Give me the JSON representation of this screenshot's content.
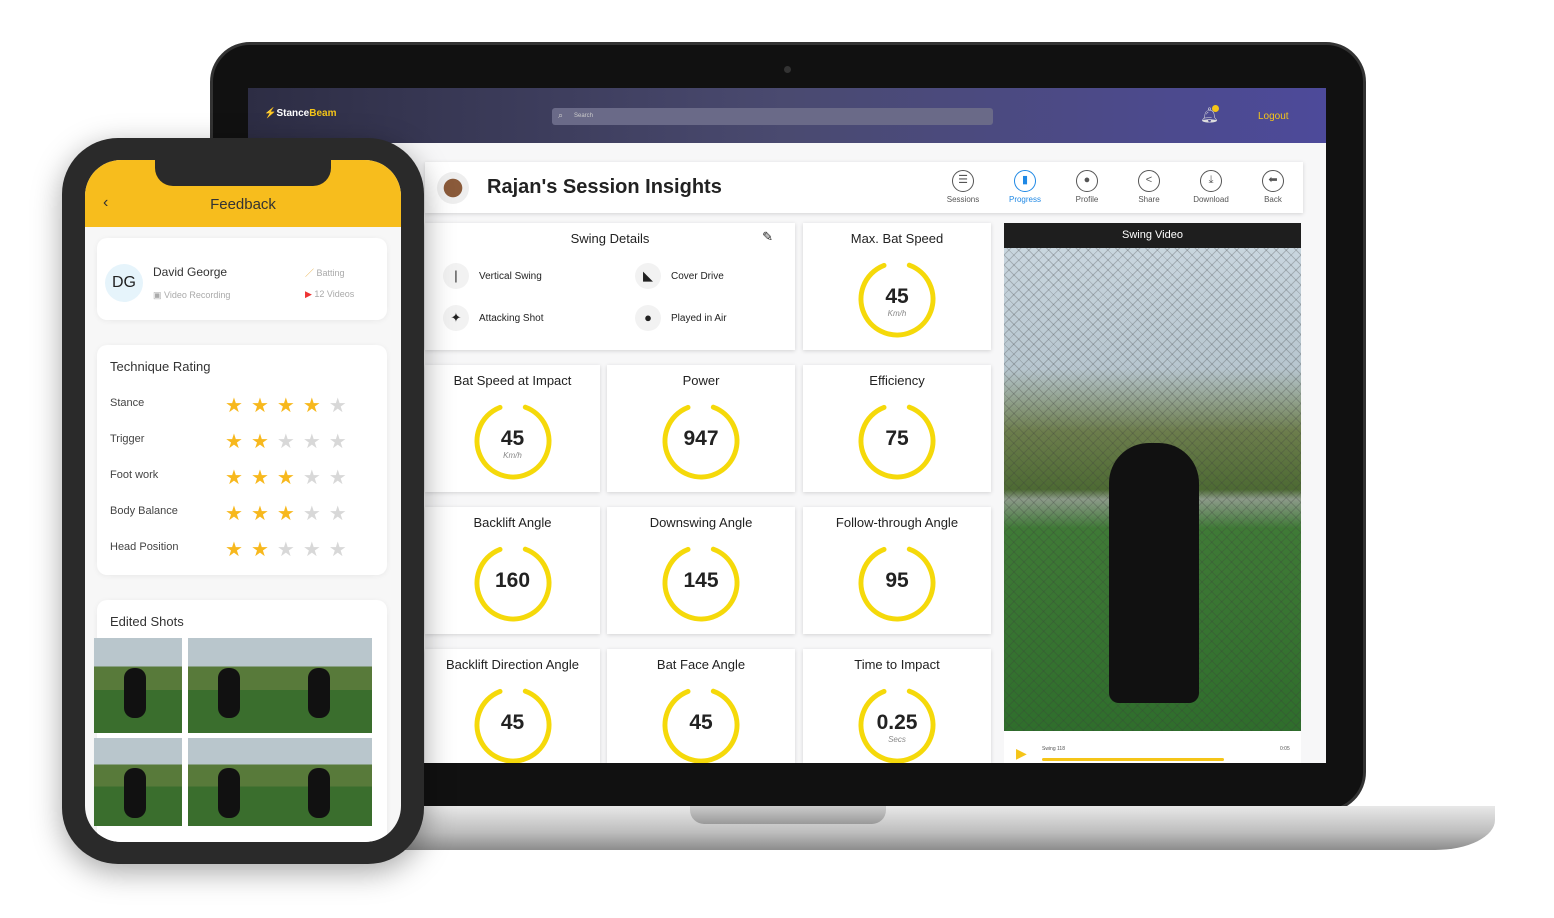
{
  "app": {
    "brand_a": "Stance",
    "brand_b": "Beam",
    "search_placeholder": "Search",
    "logout": "Logout"
  },
  "header": {
    "title": "Rajan's Session Insights",
    "nav": [
      {
        "label": "Sessions",
        "icon": "list-icon",
        "g": "☰"
      },
      {
        "label": "Progress",
        "icon": "bar-chart-icon",
        "g": "▮",
        "active": true
      },
      {
        "label": "Profile",
        "icon": "user-icon",
        "g": "●"
      },
      {
        "label": "Share",
        "icon": "share-icon",
        "g": "<"
      },
      {
        "label": "Download",
        "icon": "download-icon",
        "g": "⤓"
      },
      {
        "label": "Back",
        "icon": "back-arrow-icon",
        "g": "⬅"
      }
    ]
  },
  "swing_details": {
    "title": "Swing Details",
    "items": [
      {
        "label": "Vertical Swing",
        "g": "|"
      },
      {
        "label": "Cover Drive",
        "g": "◣"
      },
      {
        "label": "Attacking Shot",
        "g": "✦"
      },
      {
        "label": "Played in Air",
        "g": "●"
      }
    ]
  },
  "metrics": [
    {
      "title": "Max. Bat Speed",
      "value": "45",
      "unit": "Km/h"
    },
    {
      "title": "Bat Speed at Impact",
      "value": "45",
      "unit": "Km/h"
    },
    {
      "title": "Power",
      "value": "947",
      "unit": ""
    },
    {
      "title": "Efficiency",
      "value": "75",
      "unit": ""
    },
    {
      "title": "Backlift Angle",
      "value": "160",
      "unit": ""
    },
    {
      "title": "Downswing Angle",
      "value": "145",
      "unit": ""
    },
    {
      "title": "Follow-through Angle",
      "value": "95",
      "unit": ""
    },
    {
      "title": "Backlift Direction Angle",
      "value": "45",
      "unit": ""
    },
    {
      "title": "Bat Face Angle",
      "value": "45",
      "unit": ""
    },
    {
      "title": "Time to Impact",
      "value": "0.25",
      "unit": "Secs"
    }
  ],
  "video": {
    "title": "Swing Video",
    "clip": "Swing 118",
    "time": "0:05",
    "progress": 0.7
  },
  "colors": {
    "accent": "#f5c518",
    "active": "#1e88e5"
  },
  "phone": {
    "title": "Feedback",
    "initials": "DG",
    "name": "David George",
    "mode": "Batting",
    "source": "Video Recording",
    "videos": "12 Videos",
    "rating_title": "Technique Rating",
    "ratings": [
      {
        "label": "Stance",
        "stars": 4
      },
      {
        "label": "Trigger",
        "stars": 2
      },
      {
        "label": "Foot work",
        "stars": 3
      },
      {
        "label": "Body Balance",
        "stars": 3
      },
      {
        "label": "Head Position",
        "stars": 2
      }
    ],
    "shots_title": "Edited Shots"
  }
}
